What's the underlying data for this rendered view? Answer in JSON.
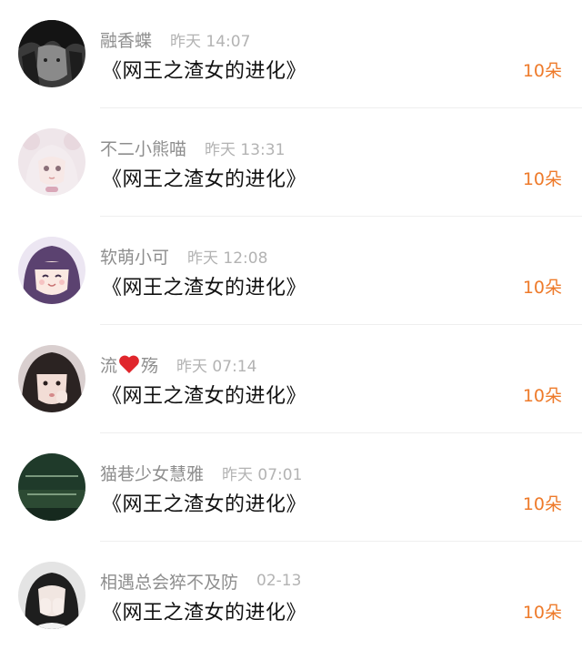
{
  "accent_color": "#ee7a2a",
  "items": [
    {
      "user": "融香蝶",
      "time": "昨天 14:07",
      "title": "《网王之渣女的进化》",
      "count": "10朵",
      "avatar": "dark-haired-anime-boy-avatar"
    },
    {
      "user": "不二小熊喵",
      "time": "昨天 13:31",
      "title": "《网王之渣女的进化》",
      "count": "10朵",
      "avatar": "white-haired-doll-girl-avatar"
    },
    {
      "user": "软萌小可",
      "time": "昨天 12:08",
      "title": "《网王之渣女的进化》",
      "count": "10朵",
      "avatar": "purple-haired-anime-girl-avatar"
    },
    {
      "user_prefix": "流",
      "user_suffix": "殇",
      "user_emoji": "red-heart-icon",
      "time": "昨天 07:14",
      "title": "《网王之渣女的进化》",
      "count": "10朵",
      "avatar": "girl-photo-avatar"
    },
    {
      "user": "猫巷少女慧雅",
      "time": "昨天 07:01",
      "title": "《网王之渣女的进化》",
      "count": "10朵",
      "avatar": "green-text-avatar"
    },
    {
      "user": "相遇总会猝不及防",
      "time": "02-13",
      "title": "《网王之渣女的进化》",
      "count": "10朵",
      "avatar": "girl-covering-face-avatar"
    }
  ]
}
